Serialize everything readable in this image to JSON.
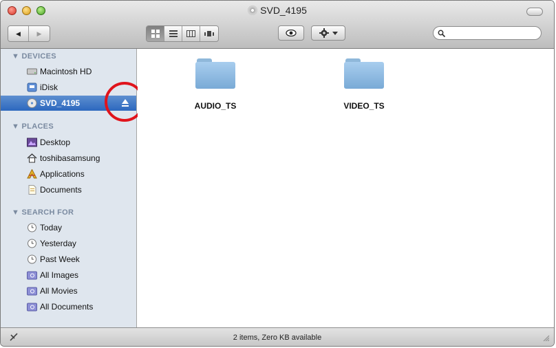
{
  "window": {
    "title": "SVD_4195"
  },
  "toolbar": {
    "back_glyph": "◀",
    "forward_glyph": "▶",
    "view_modes": [
      "icon-view",
      "list-view",
      "column-view",
      "coverflow-view"
    ],
    "search": {
      "placeholder": "",
      "value": ""
    }
  },
  "sidebar": {
    "sections": [
      {
        "header": "▼ DEVICES",
        "items": [
          {
            "label": "Macintosh HD",
            "icon": "hard-drive-icon"
          },
          {
            "label": "iDisk",
            "icon": "idisk-icon"
          },
          {
            "label": "SVD_4195",
            "icon": "disc-icon",
            "selected": true,
            "eject": "⏏"
          }
        ]
      },
      {
        "header": "▼ PLACES",
        "items": [
          {
            "label": "Desktop",
            "icon": "desktop-icon"
          },
          {
            "label": "toshibasamsung",
            "icon": "home-icon"
          },
          {
            "label": "Applications",
            "icon": "applications-icon"
          },
          {
            "label": "Documents",
            "icon": "documents-icon"
          }
        ]
      },
      {
        "header": "▼ SEARCH FOR",
        "items": [
          {
            "label": "Today",
            "icon": "clock-icon"
          },
          {
            "label": "Yesterday",
            "icon": "clock-icon"
          },
          {
            "label": "Past Week",
            "icon": "clock-icon"
          },
          {
            "label": "All Images",
            "icon": "smart-folder-icon"
          },
          {
            "label": "All Movies",
            "icon": "smart-folder-icon"
          },
          {
            "label": "All Documents",
            "icon": "smart-folder-icon"
          }
        ]
      }
    ]
  },
  "main": {
    "items": [
      {
        "name": "AUDIO_TS",
        "icon": "folder-icon"
      },
      {
        "name": "VIDEO_TS",
        "icon": "folder-icon"
      }
    ]
  },
  "status": {
    "text": "2 items, Zero KB available"
  },
  "colors": {
    "selection": "#2d68be",
    "sidebar_bg": "#dfe6ee",
    "section_header": "#7a8aa0",
    "folder": "#8fbde5",
    "annotation_circle": "#e0141c"
  }
}
